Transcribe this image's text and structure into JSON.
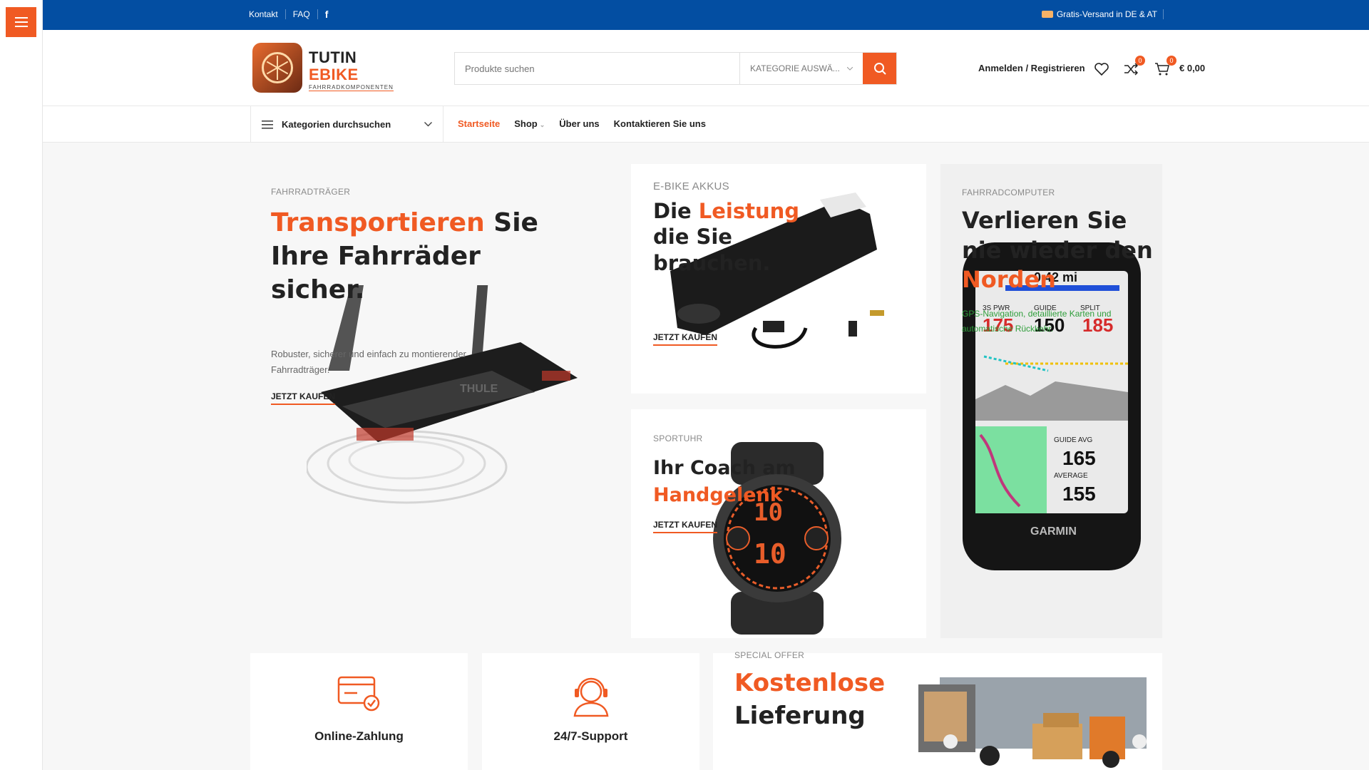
{
  "topbar": {
    "links": [
      "Kontakt",
      "FAQ"
    ],
    "facebook_icon": "facebook-icon",
    "shipping": "Gratis-Versand in DE & AT"
  },
  "logo": {
    "line1": "TUTIN",
    "line2": "EBIKE",
    "line3": "FAHRRADKOMPONENTEN"
  },
  "search": {
    "placeholder": "Produkte suchen",
    "category": "KATEGORIE AUSWÄ..."
  },
  "header": {
    "login": "Anmelden / Registrieren",
    "compare_count": "0",
    "cart_count": "0",
    "cart_total": "€ 0,00"
  },
  "nav": {
    "categories": "Kategorien durchsuchen",
    "items": [
      "Startseite",
      "Shop",
      "Über uns",
      "Kontaktieren Sie uns"
    ]
  },
  "hero_main": {
    "category": "FAHRRADTRÄGER",
    "title_accent": "Transportieren",
    "title_rest1": " Sie",
    "title_line2": "Ihre Fahrräder",
    "title_line3": "sicher.",
    "description_line1": "Robuster, sicherer und einfach zu montierender",
    "description_line2": "Fahrradträger.",
    "cta": "JETZT KAUFEN"
  },
  "battery_panel": {
    "category": "E-BIKE AKKUS",
    "title_pre": "Die ",
    "title_accent": "Leistung",
    "title_line2": "die Sie",
    "title_line3": "brauchen.",
    "cta": "JETZT KAUFEN"
  },
  "watch_panel": {
    "category": "SPORTUHR",
    "title_line1": "Ihr Coach am",
    "title_accent": "Handgelenk",
    "cta": "JETZT KAUFEN"
  },
  "computer_panel": {
    "category": "FAHRRADCOMPUTER",
    "title_line1": "Verlieren Sie",
    "title_line2": "nie wieder den",
    "title_accent": "Norden",
    "description_line1": "GPS-Navigation, detaillierte Karten und",
    "description_line2": "automatische Rückkehr.",
    "device": {
      "distance": "0.42 mi",
      "pwr_label": "3S PWR",
      "pwr_value": "175",
      "guide_label": "GUIDE",
      "guide_value": "150",
      "split_label": "SPLIT",
      "split_value": "185",
      "guide_avg_label": "GUIDE AVG",
      "guide_avg_value": "165",
      "average_label": "AVERAGE",
      "average_value": "155",
      "brand": "GARMIN"
    }
  },
  "watch_face": {
    "value1": "10",
    "value2": "10"
  },
  "features": [
    {
      "label": "Online-Zahlung",
      "icon": "credit-card-icon"
    },
    {
      "label": "24/7-Support",
      "icon": "support-agent-icon"
    }
  ],
  "offer": {
    "category": "SPECIAL OFFER",
    "title_accent": "Kostenlose",
    "title_line2": "Lieferung"
  },
  "colors": {
    "accent": "#f05a23",
    "topbar": "#034ea2"
  }
}
